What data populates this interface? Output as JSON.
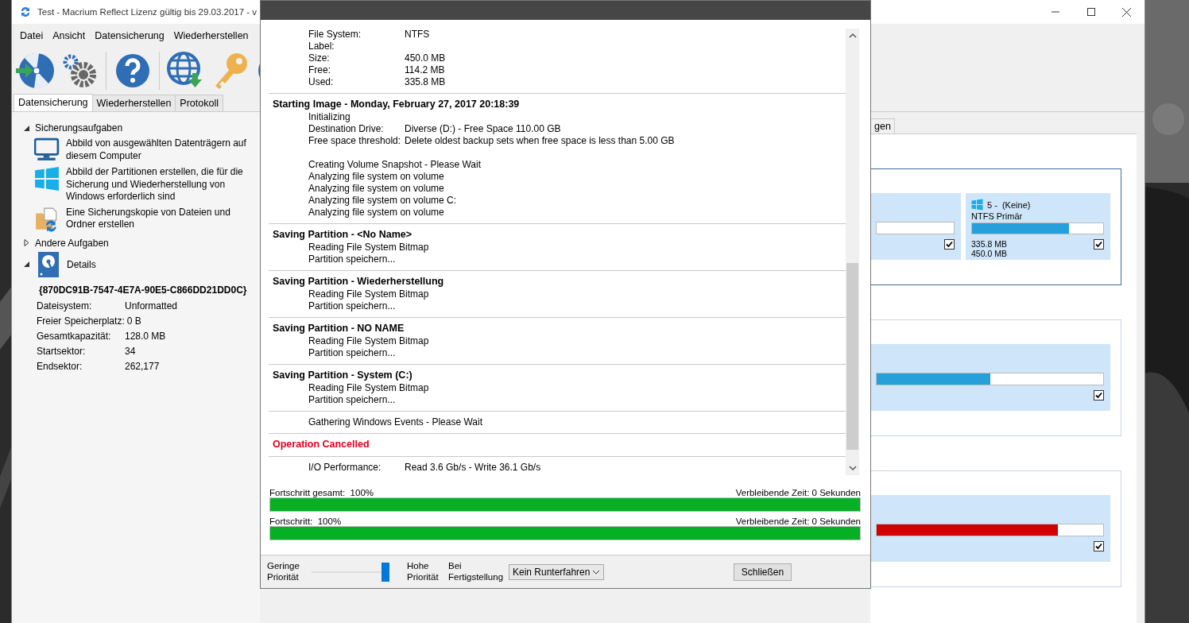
{
  "main_window": {
    "title": "Test - Macrium Reflect Lizenz gültig bis 29.03.2017 - v",
    "menu": [
      "Datei",
      "Ansicht",
      "Datensicherung",
      "Wiederherstellen"
    ],
    "tabs": [
      {
        "label": "Datensicherung",
        "selected": true
      },
      {
        "label": "Wiederherstellen",
        "selected": false
      },
      {
        "label": "Protokoll",
        "selected": false
      }
    ],
    "tasks": [
      {
        "label": "Sicherungsaufgaben",
        "expanded": true,
        "children": [
          {
            "kind": "monitor",
            "label": "Abbild von ausgewählten Datenträgern auf diesem Computer"
          },
          {
            "kind": "windows",
            "label": "Abbild der Partitionen erstellen, die für die Sicherung und Wiederherstellung von Windows erforderlich sind"
          },
          {
            "kind": "folder",
            "label": "Eine Sicherungskopie von Dateien und Ordner erstellen"
          }
        ]
      },
      {
        "label": "Andere Aufgaben",
        "expanded": false
      }
    ],
    "details": {
      "title": "Details",
      "expanded": true,
      "guid": "{870DC91B-7547-4E7A-90E5-C866DD21DD0C}",
      "rows": [
        {
          "label": "Dateisystem:",
          "value": "Unformatted"
        },
        {
          "label": "Freier Speicherplatz:",
          "value": "0 B"
        },
        {
          "label": "Gesamtkapazität:",
          "value": "128.0 MB"
        },
        {
          "label": "Startsektor:",
          "value": "34"
        },
        {
          "label": "Endsektor:",
          "value": "262,177"
        }
      ]
    },
    "right_tab": {
      "label": "gen"
    },
    "disks": [
      {
        "selected": true,
        "partitions": [
          {
            "checked": true
          },
          {
            "name": "5 -  (Keine)",
            "type": "NTFS Primär",
            "level": 0.74,
            "color": "#26a0da",
            "used": "335.8 MB",
            "total": "450.0 MB",
            "checked": true
          }
        ]
      },
      {
        "selected": false,
        "partitions": [
          {
            "level": 0.5,
            "color": "#26a0da",
            "checked": true
          }
        ]
      },
      {
        "selected": false,
        "partitions": [
          {
            "level": 0.8,
            "color": "#d20000",
            "checked": true
          }
        ]
      }
    ]
  },
  "dialog": {
    "log": [
      {
        "lines": [
          {
            "kind": "field",
            "label": "File System:",
            "value": "NTFS"
          },
          {
            "kind": "field",
            "label": "Label:"
          },
          {
            "kind": "field",
            "label": "Size:",
            "value": "450.0 MB"
          },
          {
            "kind": "field",
            "label": "Free:",
            "value": "114.2 MB"
          },
          {
            "kind": "field",
            "label": "Used:",
            "value": "335.8 MB"
          }
        ]
      },
      {
        "heading": "Starting Image - Monday, February 27, 2017 20:18:39",
        "error": false,
        "lines": [
          {
            "kind": "text",
            "text": "Initializing"
          },
          {
            "kind": "field",
            "label": "Destination Drive:",
            "value": "Diverse (D:) - Free Space 110.00 GB"
          },
          {
            "kind": "field",
            "label": "Free space threshold:",
            "value": "Delete oldest backup sets when free space is less than 5.00 GB"
          },
          {
            "kind": "spacer"
          },
          {
            "kind": "text",
            "text": "Creating Volume Snapshot - Please Wait"
          },
          {
            "kind": "text",
            "text": "Analyzing file system on volume"
          },
          {
            "kind": "text",
            "text": "Analyzing file system on volume"
          },
          {
            "kind": "text",
            "text": "Analyzing file system on volume C:"
          },
          {
            "kind": "text",
            "text": "Analyzing file system on volume"
          }
        ]
      },
      {
        "heading": "Saving Partition - <No Name>",
        "error": false,
        "lines": [
          {
            "kind": "text",
            "text": "Reading File System Bitmap"
          },
          {
            "kind": "text",
            "text": "Partition speichern..."
          }
        ]
      },
      {
        "heading": "Saving Partition - Wiederherstellung",
        "error": false,
        "lines": [
          {
            "kind": "text",
            "text": "Reading File System Bitmap"
          },
          {
            "kind": "text",
            "text": "Partition speichern..."
          }
        ]
      },
      {
        "heading": "Saving Partition - NO NAME",
        "error": false,
        "lines": [
          {
            "kind": "text",
            "text": "Reading File System Bitmap"
          },
          {
            "kind": "text",
            "text": "Partition speichern..."
          }
        ]
      },
      {
        "heading": "Saving Partition - System (C:)",
        "error": false,
        "lines": [
          {
            "kind": "text",
            "text": "Reading File System Bitmap"
          },
          {
            "kind": "text",
            "text": "Partition speichern..."
          }
        ]
      },
      {
        "lines": [
          {
            "kind": "text",
            "text": "Gathering Windows Events - Please Wait"
          }
        ]
      },
      {
        "heading": "Operation Cancelled",
        "error": true
      },
      {
        "lines": [
          {
            "kind": "field",
            "label": "I/O Performance:",
            "value": "Read 3.6 Gb/s - Write 36.1 Gb/s"
          }
        ]
      }
    ],
    "progress": [
      {
        "label": "Fortschritt gesamt:",
        "percent": "100%",
        "remaining": "Verbleibende Zeit: 0 Sekunden",
        "level": 1
      },
      {
        "label": "Fortschritt:",
        "percent": "100%",
        "remaining": "Verbleibende Zeit: 0 Sekunden",
        "level": 1
      }
    ],
    "priority": {
      "low_label": "Geringe Priorität",
      "high_label": "Hohe Priorität",
      "level": 1
    },
    "completion": {
      "label": "Bei Fertigstellung",
      "value": "Kein Runterfahren"
    },
    "close_button": "Schließen"
  }
}
